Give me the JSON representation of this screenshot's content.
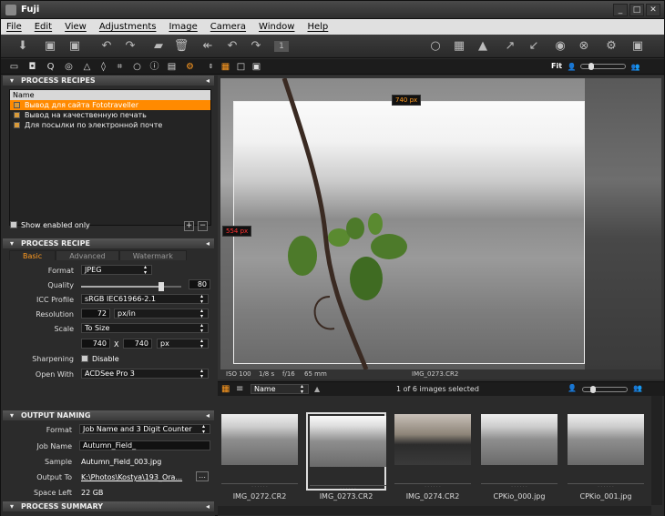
{
  "window": {
    "title": "Fuji"
  },
  "menu": [
    "File",
    "Edit",
    "View",
    "Adjustments",
    "Image",
    "Camera",
    "Window",
    "Help"
  ],
  "process_recipes": {
    "header": "PROCESS RECIPES",
    "list_header": "Name",
    "items": [
      "Вывод для сайта Fototraveller",
      "Вывод на качественную печать",
      "Для посылки по электронной почте"
    ],
    "show_enabled_only": "Show enabled only"
  },
  "process_recipe": {
    "header": "PROCESS RECIPE",
    "tabs": [
      "Basic",
      "Advanced",
      "Watermark"
    ],
    "format_label": "Format",
    "format_value": "JPEG",
    "quality_label": "Quality",
    "quality_value": "80",
    "quality_level": 0.8,
    "icc_label": "ICC Profile",
    "icc_value": "sRGB IEC61966-2.1",
    "resolution_label": "Resolution",
    "resolution_value": "72",
    "resolution_unit": "px/in",
    "scale_label": "Scale",
    "scale_value": "To Size",
    "width": "740",
    "x_sep": "X",
    "height": "740",
    "size_unit": "px",
    "sharpening_label": "Sharpening",
    "sharpening_value": "Disable",
    "open_with_label": "Open With",
    "open_with_value": "ACDSee Pro 3"
  },
  "output_naming": {
    "header": "OUTPUT NAMING",
    "format_label": "Format",
    "format_value": "Job Name and 3 Digit Counter",
    "job_label": "Job Name",
    "job_value": "Autumn_Field_",
    "sample_label": "Sample",
    "sample_value": "Autumn_Field_003.jpg",
    "output_label": "Output To",
    "output_value": "K:\\Photos\\Kostya\\193_Ora...",
    "space_label": "Space Left",
    "space_value": "22 GB"
  },
  "process_summary": {
    "header": "PROCESS SUMMARY"
  },
  "viewer": {
    "zoom": "Fit",
    "width_tag": "740 px",
    "height_tag": "554 px",
    "iso": "ISO 100",
    "shutter": "1/8 s",
    "aperture": "f/16",
    "focal": "65 mm",
    "filename": "IMG_0273.CR2"
  },
  "browser": {
    "sort": "Name",
    "count": "1 of 6 images selected",
    "thumbnails": [
      "IMG_0272.CR2",
      "IMG_0273.CR2",
      "IMG_0274.CR2",
      "CPKio_000.jpg",
      "CPKio_001.jpg"
    ]
  }
}
